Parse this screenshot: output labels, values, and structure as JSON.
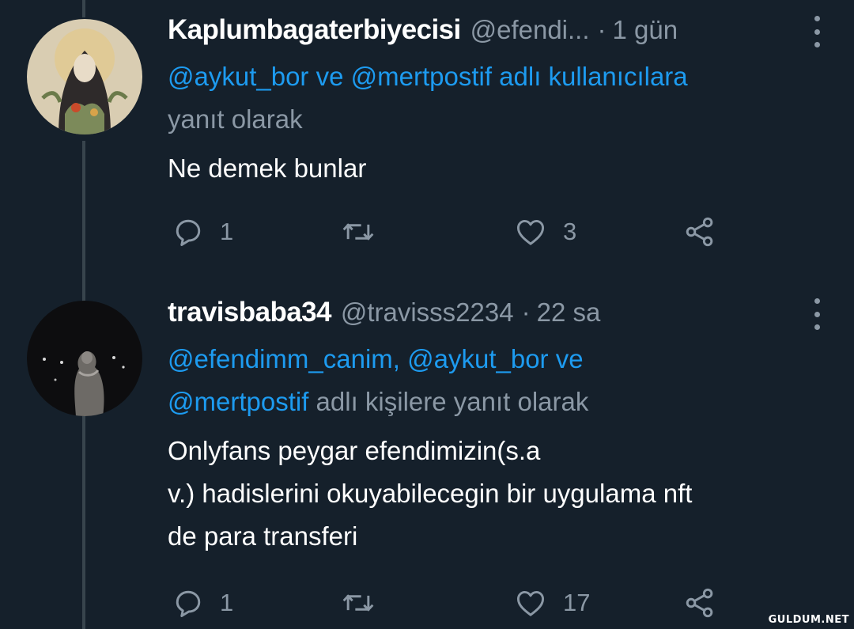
{
  "tweets": [
    {
      "name": "Kaplumbagaterbiyecisi",
      "handle": "@efendi...",
      "separator": "·",
      "time": "1 gün",
      "reply_mentions": [
        "@aykut_bor",
        "@mertpostif"
      ],
      "reply_joiners": [
        " ve ",
        " adlı kullanıcılara"
      ],
      "reply_tail": "yanıt olarak",
      "text": "Ne demek bunlar",
      "reply_count": "1",
      "retweet_count": "",
      "like_count": "3"
    },
    {
      "name": "travisbaba34",
      "handle": "@travisss2234",
      "separator": "·",
      "time": "22 sa",
      "reply_mentions": [
        "@efendimm_canim,",
        "@aykut_bor",
        "@mertpostif"
      ],
      "reply_joiners": [
        " ",
        " ve",
        " adlı kişilere yanıt olarak"
      ],
      "text_lines": [
        "Onlyfans peygar efendimizin(s.a",
        "v.) hadislerini okuyabilecegin bir uygulama nft",
        "de para transferi"
      ],
      "reply_count": "1",
      "retweet_count": "",
      "like_count": "17"
    }
  ],
  "icons": [
    "reply-icon",
    "retweet-icon",
    "like-icon",
    "share-icon",
    "more-icon"
  ],
  "colors": {
    "background": "#15202b",
    "accent": "#1d9bf0",
    "muted": "#8b98a5"
  },
  "watermark": "GULDUM.NET"
}
